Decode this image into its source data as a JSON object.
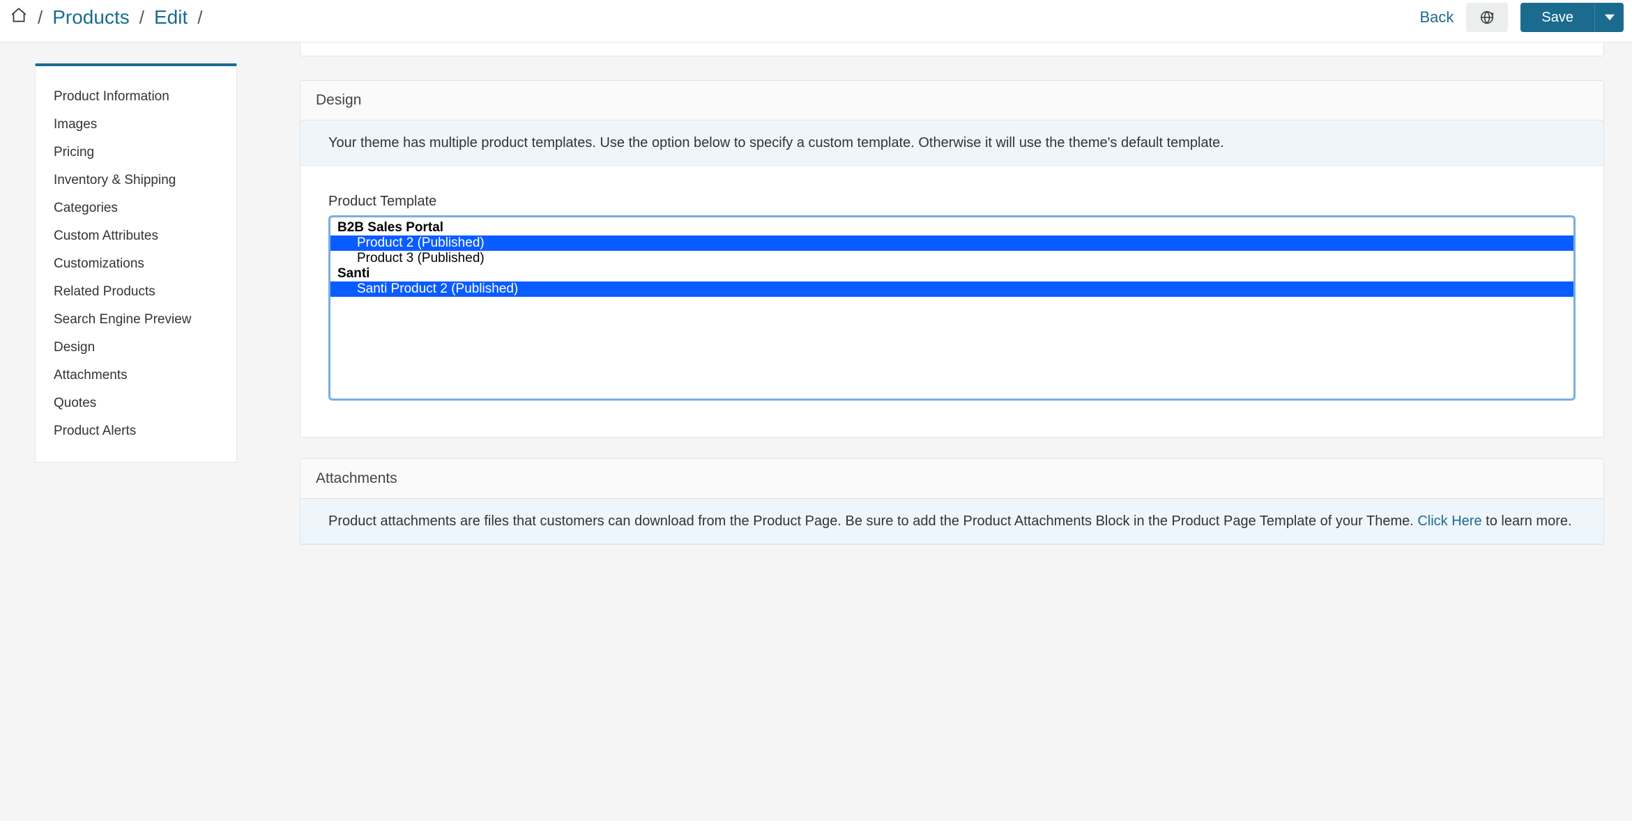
{
  "breadcrumb": {
    "products": "Products",
    "edit": "Edit"
  },
  "header": {
    "back": "Back",
    "save": "Save"
  },
  "sidebar": {
    "items": [
      "Product Information",
      "Images",
      "Pricing",
      "Inventory & Shipping",
      "Categories",
      "Custom Attributes",
      "Customizations",
      "Related Products",
      "Search Engine Preview",
      "Design",
      "Attachments",
      "Quotes",
      "Product Alerts"
    ]
  },
  "design": {
    "title": "Design",
    "info": "Your theme has multiple product templates. Use the option below to specify a custom template. Otherwise it will use the theme's default template.",
    "field_label": "Product Template",
    "groups": [
      {
        "name": "B2B Sales Portal",
        "options": [
          {
            "label": "Product 2 (Published)",
            "selected": true
          },
          {
            "label": "Product 3 (Published)",
            "selected": false
          }
        ]
      },
      {
        "name": "Santi",
        "options": [
          {
            "label": "Santi Product 2 (Published)",
            "selected": true
          }
        ]
      }
    ]
  },
  "attachments": {
    "title": "Attachments",
    "info_pre": "Product attachments are files that customers can download from the Product Page. Be sure to add the Product Attachments Block in the Product Page Template of your Theme. ",
    "link": "Click Here",
    "info_post": " to learn more."
  }
}
